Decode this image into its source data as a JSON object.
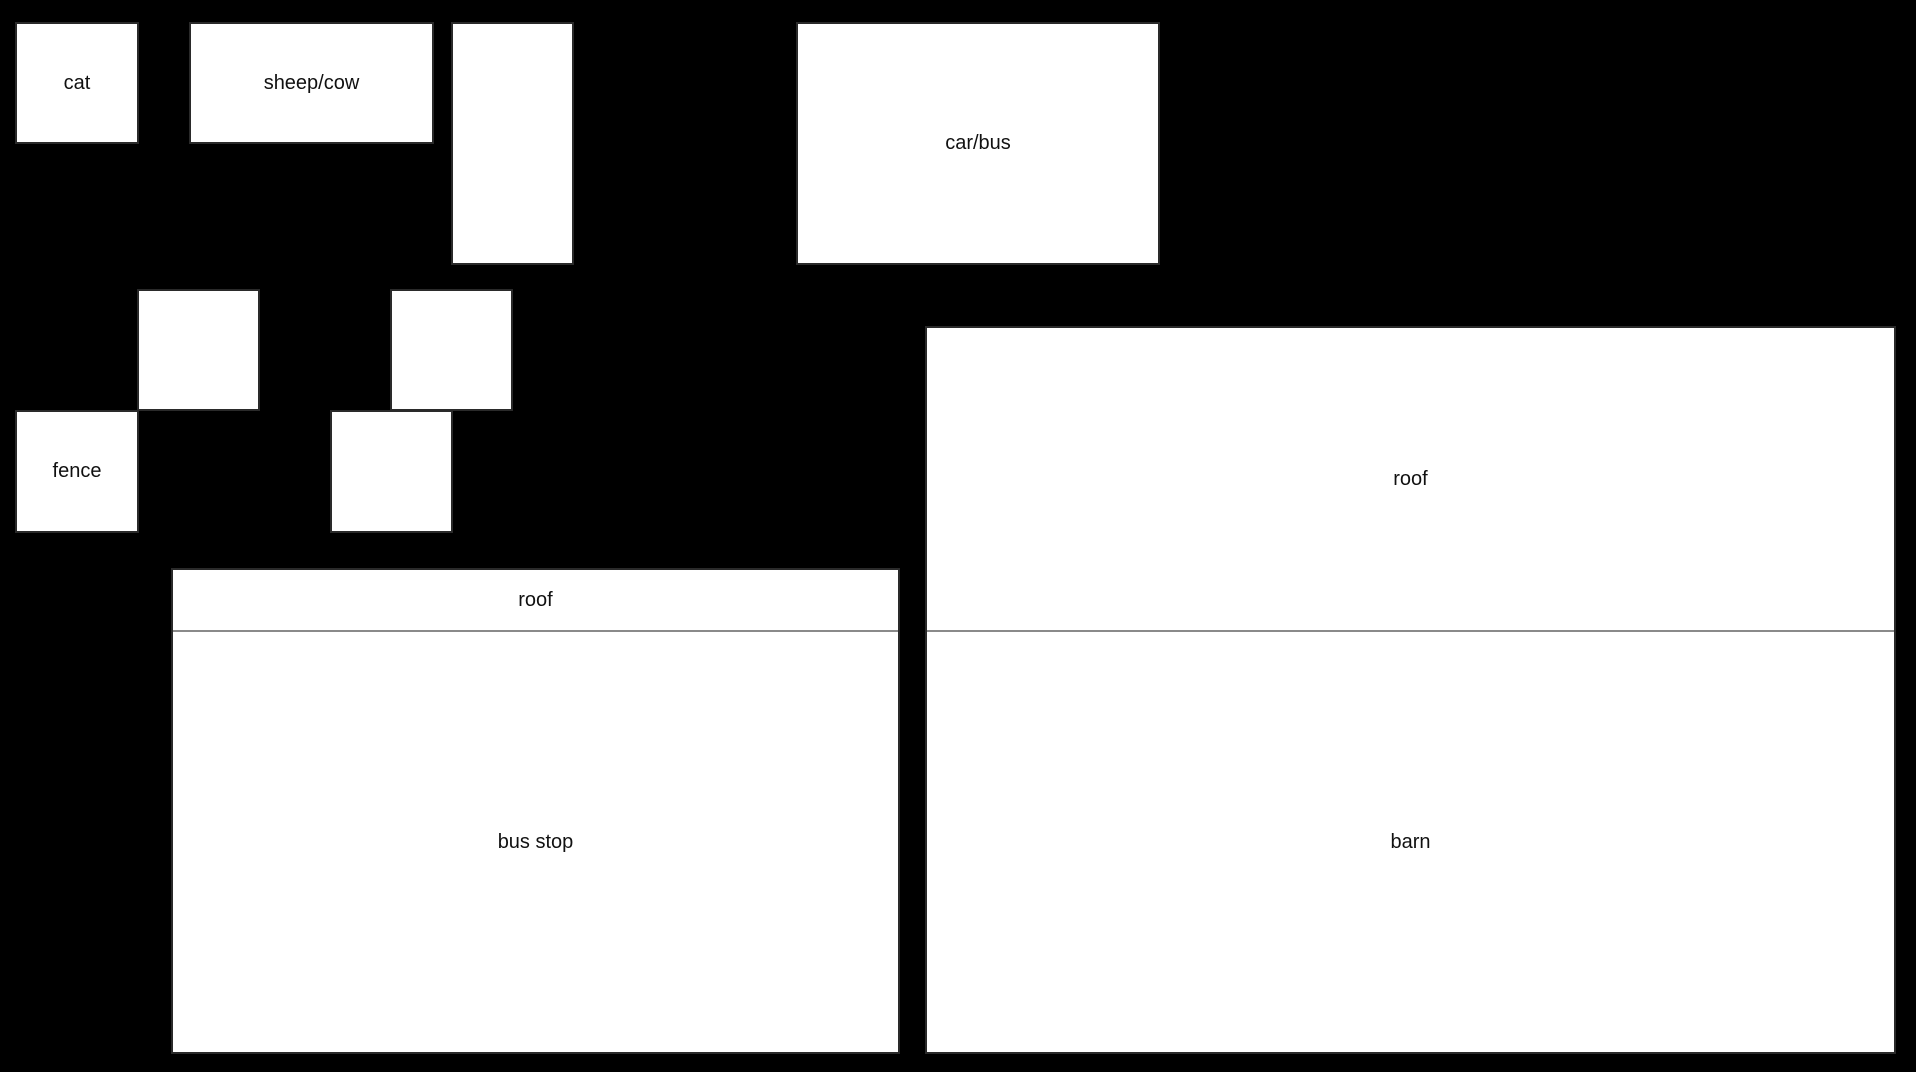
{
  "colors": {
    "background": "#000000",
    "box_fill": "#ffffff",
    "box_border": "#2a2a2a",
    "divider": "#8a8a8a",
    "text": "#111111"
  },
  "boxes": {
    "cat": "cat",
    "sheep_cow": "sheep/cow",
    "car_bus": "car/bus",
    "fence": "fence"
  },
  "bus_stop": {
    "roof": "roof",
    "label": "bus stop"
  },
  "barn": {
    "roof": "roof",
    "label": "barn"
  }
}
